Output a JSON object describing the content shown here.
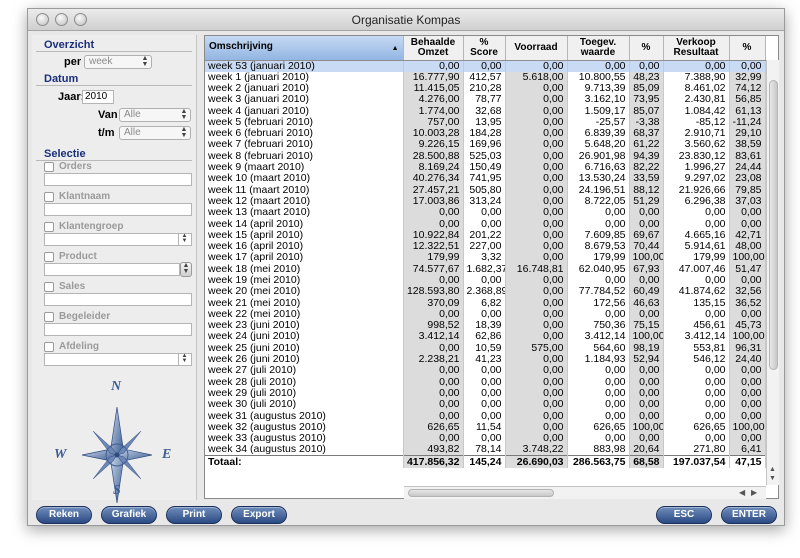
{
  "window": {
    "title": "Organisatie Kompas"
  },
  "sidebar": {
    "overzicht": {
      "title": "Overzicht",
      "per_label": "per",
      "per_value": "week"
    },
    "datum": {
      "title": "Datum",
      "jaar_label": "Jaar:",
      "jaar_value": "2010",
      "van_label": "Van",
      "van_value": "Alle",
      "tm_label": "t/m",
      "tm_value": "Alle"
    },
    "selectie": {
      "title": "Selectie",
      "filters": [
        "Orders",
        "Klantnaam",
        "Klantengroep",
        "Product",
        "Sales",
        "Begeleider",
        "Afdeling"
      ]
    },
    "compass": {
      "n": "N",
      "e": "E",
      "s": "S",
      "w": "W"
    }
  },
  "table": {
    "columns": [
      "Omschrijving",
      "Behaalde Omzet",
      "% Score",
      "Voorraad",
      "Toegev. waarde",
      "%",
      "Verkoop Resultaat",
      "%"
    ],
    "rows": [
      [
        "week 53 (januari 2010)",
        "0,00",
        "0,00",
        "0,00",
        "0,00",
        "0,00",
        "0,00",
        "0,00"
      ],
      [
        "week 1 (januari 2010)",
        "16.777,90",
        "412,57",
        "5.618,00",
        "10.800,55",
        "48,23",
        "7.388,90",
        "32,99"
      ],
      [
        "week 2 (januari 2010)",
        "11.415,05",
        "210,28",
        "0,00",
        "9.713,39",
        "85,09",
        "8.461,02",
        "74,12"
      ],
      [
        "week 3 (januari 2010)",
        "4.276,00",
        "78,77",
        "0,00",
        "3.162,10",
        "73,95",
        "2.430,81",
        "56,85"
      ],
      [
        "week 4 (januari 2010)",
        "1.774,00",
        "32,68",
        "0,00",
        "1.509,17",
        "85,07",
        "1.084,42",
        "61,13"
      ],
      [
        "week 5 (februari 2010)",
        "757,00",
        "13,95",
        "0,00",
        "-25,57",
        "-3,38",
        "-85,12",
        "-11,24"
      ],
      [
        "week 6 (februari 2010)",
        "10.003,28",
        "184,28",
        "0,00",
        "6.839,39",
        "68,37",
        "2.910,71",
        "29,10"
      ],
      [
        "week 7 (februari 2010)",
        "9.226,15",
        "169,96",
        "0,00",
        "5.648,20",
        "61,22",
        "3.560,62",
        "38,59"
      ],
      [
        "week 8 (februari 2010)",
        "28.500,88",
        "525,03",
        "0,00",
        "26.901,98",
        "94,39",
        "23.830,12",
        "83,61"
      ],
      [
        "week 9 (maart 2010)",
        "8.169,24",
        "150,49",
        "0,00",
        "6.716,63",
        "82,22",
        "1.996,27",
        "24,44"
      ],
      [
        "week 10 (maart 2010)",
        "40.276,34",
        "741,95",
        "0,00",
        "13.530,24",
        "33,59",
        "9.297,02",
        "23,08"
      ],
      [
        "week 11 (maart 2010)",
        "27.457,21",
        "505,80",
        "0,00",
        "24.196,51",
        "88,12",
        "21.926,66",
        "79,85"
      ],
      [
        "week 12 (maart 2010)",
        "17.003,86",
        "313,24",
        "0,00",
        "8.722,05",
        "51,29",
        "6.296,38",
        "37,03"
      ],
      [
        "week 13 (maart 2010)",
        "0,00",
        "0,00",
        "0,00",
        "0,00",
        "0,00",
        "0,00",
        "0,00"
      ],
      [
        "week 14 (april 2010)",
        "0,00",
        "0,00",
        "0,00",
        "0,00",
        "0,00",
        "0,00",
        "0,00"
      ],
      [
        "week 15 (april 2010)",
        "10.922,84",
        "201,22",
        "0,00",
        "7.609,85",
        "69,67",
        "4.665,16",
        "42,71"
      ],
      [
        "week 16 (april 2010)",
        "12.322,51",
        "227,00",
        "0,00",
        "8.679,53",
        "70,44",
        "5.914,61",
        "48,00"
      ],
      [
        "week 17 (april 2010)",
        "179,99",
        "3,32",
        "0,00",
        "179,99",
        "100,00",
        "179,99",
        "100,00"
      ],
      [
        "week 18 (mei 2010)",
        "74.577,67",
        "1.682,37",
        "16.748,81",
        "62.040,95",
        "67,93",
        "47.007,46",
        "51,47"
      ],
      [
        "week 19 (mei 2010)",
        "0,00",
        "0,00",
        "0,00",
        "0,00",
        "0,00",
        "0,00",
        "0,00"
      ],
      [
        "week 20 (mei 2010)",
        "128.593,80",
        "2.368,89",
        "0,00",
        "77.784,52",
        "60,49",
        "41.874,62",
        "32,56"
      ],
      [
        "week 21 (mei 2010)",
        "370,09",
        "6,82",
        "0,00",
        "172,56",
        "46,63",
        "135,15",
        "36,52"
      ],
      [
        "week 22 (mei 2010)",
        "0,00",
        "0,00",
        "0,00",
        "0,00",
        "0,00",
        "0,00",
        "0,00"
      ],
      [
        "week 23 (juni 2010)",
        "998,52",
        "18,39",
        "0,00",
        "750,36",
        "75,15",
        "456,61",
        "45,73"
      ],
      [
        "week 24 (juni 2010)",
        "3.412,14",
        "62,86",
        "0,00",
        "3.412,14",
        "100,00",
        "3.412,14",
        "100,00"
      ],
      [
        "week 25 (juni 2010)",
        "0,00",
        "10,59",
        "575,00",
        "564,60",
        "98,19",
        "553,81",
        "96,31"
      ],
      [
        "week 26 (juni 2010)",
        "2.238,21",
        "41,23",
        "0,00",
        "1.184,93",
        "52,94",
        "546,12",
        "24,40"
      ],
      [
        "week 27 (juli 2010)",
        "0,00",
        "0,00",
        "0,00",
        "0,00",
        "0,00",
        "0,00",
        "0,00"
      ],
      [
        "week 28 (juli 2010)",
        "0,00",
        "0,00",
        "0,00",
        "0,00",
        "0,00",
        "0,00",
        "0,00"
      ],
      [
        "week 29 (juli 2010)",
        "0,00",
        "0,00",
        "0,00",
        "0,00",
        "0,00",
        "0,00",
        "0,00"
      ],
      [
        "week 30 (juli 2010)",
        "0,00",
        "0,00",
        "0,00",
        "0,00",
        "0,00",
        "0,00",
        "0,00"
      ],
      [
        "week 31 (augustus 2010)",
        "0,00",
        "0,00",
        "0,00",
        "0,00",
        "0,00",
        "0,00",
        "0,00"
      ],
      [
        "week 32 (augustus 2010)",
        "626,65",
        "11,54",
        "0,00",
        "626,65",
        "100,00",
        "626,65",
        "100,00"
      ],
      [
        "week 33 (augustus 2010)",
        "0,00",
        "0,00",
        "0,00",
        "0,00",
        "0,00",
        "0,00",
        "0,00"
      ],
      [
        "week 34 (augustus 2010)",
        "493,82",
        "78,14",
        "3.748,22",
        "883,98",
        "20,64",
        "271,80",
        "6,41"
      ]
    ],
    "totals": [
      "Totaal:",
      "417.856,32",
      "145,24",
      "26.690,03",
      "286.563,75",
      "68,58",
      "197.037,54",
      "47,15"
    ]
  },
  "buttons": {
    "reken": "Reken",
    "grafiek": "Grafiek",
    "print": "Print",
    "export": "Export",
    "esc": "ESC",
    "enter": "ENTER"
  },
  "colors": {
    "accent": "#2c4a83",
    "section_title": "#1a2f7a",
    "selected_header": "#92b5e2",
    "shaded_column": "#dcdcdc"
  }
}
